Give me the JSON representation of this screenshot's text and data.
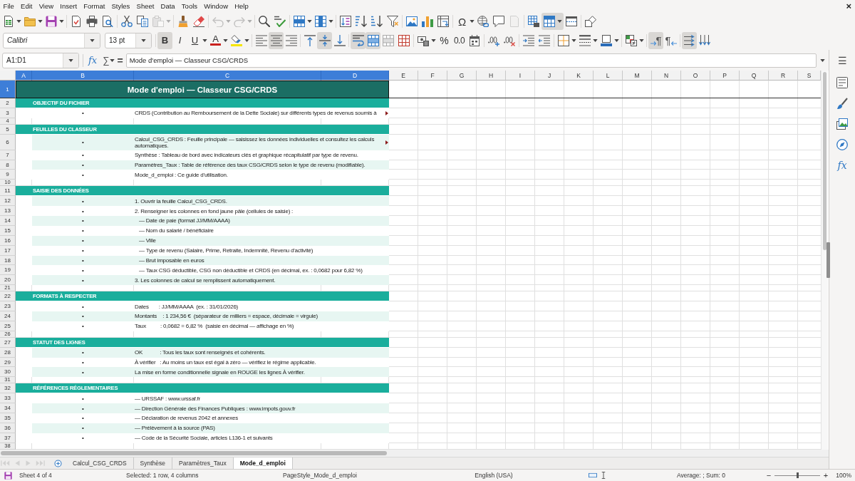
{
  "menu_bar": {
    "items": [
      "File",
      "Edit",
      "View",
      "Insert",
      "Format",
      "Styles",
      "Sheet",
      "Data",
      "Tools",
      "Window",
      "Help"
    ],
    "close_glyph": "×"
  },
  "standard_toolbar": {
    "paste_disabled": true,
    "undo_disabled": true,
    "redo_disabled": true,
    "header_footer_disabled": true,
    "special_character_glyph": "Ω",
    "freeze_active": true
  },
  "formatting_toolbar": {
    "font_name": "Calibri",
    "font_size": "13 pt",
    "bold": {
      "glyph": "B",
      "on": true
    },
    "italic": {
      "glyph": "I",
      "on": false
    },
    "underline": {
      "glyph": "U",
      "on": false
    },
    "font_color_glyph": "A",
    "horizontal_align": [
      {
        "kind": "left",
        "selected": false
      },
      {
        "kind": "center",
        "selected": true
      },
      {
        "kind": "right",
        "selected": false
      }
    ],
    "vertical_align": [
      {
        "kind": "top",
        "selected": false
      },
      {
        "kind": "middle",
        "selected": true
      },
      {
        "kind": "bottom",
        "selected": false
      }
    ],
    "wrap_text": true,
    "merge_and_center": true,
    "percent_glyph": "%",
    "standard_glyph": "0.0",
    "paragraph_direction": [
      {
        "kind": "ltr",
        "glyph": "¶",
        "selected": true
      },
      {
        "kind": "rtl",
        "glyph": "¶",
        "selected": false
      }
    ],
    "text_orientation": [
      {
        "kind": "horizontal",
        "selected": true
      },
      {
        "kind": "vertical",
        "selected": false
      }
    ]
  },
  "formula_bar": {
    "name_box": "A1:D1",
    "function_glyph": "fx",
    "sum_glyph": "∑",
    "equals_glyph": "=",
    "content": "Mode d'emploi — Classeur CSG/CRDS"
  },
  "sidebar": {
    "menu_glyph": "☰",
    "functions_glyph": "fx"
  },
  "sheet": {
    "columns": [
      {
        "label": "A",
        "selected": true
      },
      {
        "label": "B",
        "selected": true
      },
      {
        "label": "C",
        "selected": true
      },
      {
        "label": "D",
        "selected": true
      },
      {
        "label": "E",
        "selected": false
      },
      {
        "label": "F",
        "selected": false
      },
      {
        "label": "G",
        "selected": false
      },
      {
        "label": "H",
        "selected": false
      },
      {
        "label": "I",
        "selected": false
      },
      {
        "label": "J",
        "selected": false
      },
      {
        "label": "K",
        "selected": false
      },
      {
        "label": "L",
        "selected": false
      },
      {
        "label": "M",
        "selected": false
      },
      {
        "label": "N",
        "selected": false
      },
      {
        "label": "O",
        "selected": false
      },
      {
        "label": "P",
        "selected": false
      },
      {
        "label": "Q",
        "selected": false
      },
      {
        "label": "R",
        "selected": false
      },
      {
        "label": "S",
        "selected": false
      }
    ],
    "rows": [
      {
        "number": "1",
        "kind": "title",
        "selected": true,
        "text": "Mode d'emploi — Classeur CSG/CRDS"
      },
      {
        "number": "2",
        "kind": "section",
        "selected": false,
        "text": "OBJECTIF DU FICHIER"
      },
      {
        "number": "3",
        "kind": "item",
        "selected": false,
        "bullet": "•",
        "text": "CRDS (Contribution au Remboursement de la Dette Sociale) sur différents types de revenus soumis à",
        "shaded": false,
        "overflow": true
      },
      {
        "number": "4",
        "kind": "spacer",
        "selected": false
      },
      {
        "number": "5",
        "kind": "section",
        "selected": false,
        "text": "FEUILLES DU CLASSEUR"
      },
      {
        "number": "6",
        "kind": "item",
        "selected": false,
        "bullet": "•",
        "text": "Calcul_CSG_CRDS : Feuille principale — saisissez les données individuelles et consultez les calculs automatiques.",
        "shaded": true,
        "overflow": true
      },
      {
        "number": "7",
        "kind": "item",
        "selected": false,
        "bullet": "•",
        "text": "Synthèse : Tableau de bord avec indicateurs clés et graphique récapitulatif par type de revenu.",
        "shaded": false,
        "overflow": false
      },
      {
        "number": "8",
        "kind": "item",
        "selected": false,
        "bullet": "•",
        "text": "Paramètres_Taux : Table de référence des taux CSG/CRDS selon le type de revenu (modifiable).",
        "shaded": true,
        "overflow": false
      },
      {
        "number": "9",
        "kind": "item",
        "selected": false,
        "bullet": "•",
        "text": "Mode_d_emploi : Ce guide d'utilisation.",
        "shaded": false,
        "overflow": false
      },
      {
        "number": "10",
        "kind": "spacer",
        "selected": false
      },
      {
        "number": "11",
        "kind": "section",
        "selected": false,
        "text": "SAISIE DES DONNÉES"
      },
      {
        "number": "12",
        "kind": "item",
        "selected": false,
        "bullet": "•",
        "text": "1. Ouvrir la feuille Calcul_CSG_CRDS.",
        "shaded": true,
        "overflow": false
      },
      {
        "number": "13",
        "kind": "item",
        "selected": false,
        "bullet": "•",
        "text": "2. Renseigner les colonnes en fond jaune pâle (cellules de saisie) :",
        "shaded": false,
        "overflow": false
      },
      {
        "number": "14",
        "kind": "item",
        "selected": false,
        "bullet": "•",
        "text": "   — Date de paie (format JJ/MM/AAAA)",
        "shaded": true,
        "overflow": false
      },
      {
        "number": "15",
        "kind": "item",
        "selected": false,
        "bullet": "•",
        "text": "   — Nom du salarié / bénéficiaire",
        "shaded": false,
        "overflow": false
      },
      {
        "number": "16",
        "kind": "item",
        "selected": false,
        "bullet": "•",
        "text": "   — Ville",
        "shaded": true,
        "overflow": false
      },
      {
        "number": "17",
        "kind": "item",
        "selected": false,
        "bullet": "•",
        "text": "   — Type de revenu (Salaire, Prime, Retraite, Indemnité, Revenu d'activité)",
        "shaded": false,
        "overflow": false
      },
      {
        "number": "18",
        "kind": "item",
        "selected": false,
        "bullet": "•",
        "text": "   — Brut imposable en euros",
        "shaded": true,
        "overflow": false
      },
      {
        "number": "19",
        "kind": "item",
        "selected": false,
        "bullet": "•",
        "text": "   — Taux CSG déductible, CSG non déductible et CRDS (en décimal, ex. : 0,0682 pour 6,82 %)",
        "shaded": false,
        "overflow": false
      },
      {
        "number": "20",
        "kind": "item",
        "selected": false,
        "bullet": "•",
        "text": "3. Les colonnes de calcul se remplissent automatiquement.",
        "shaded": true,
        "overflow": false
      },
      {
        "number": "21",
        "kind": "spacer",
        "selected": false
      },
      {
        "number": "22",
        "kind": "section",
        "selected": false,
        "text": "FORMATS À RESPECTER"
      },
      {
        "number": "23",
        "kind": "item",
        "selected": false,
        "bullet": "•",
        "text": "Dates       : JJ/MM/AAAA  (ex. : 31/01/2026)",
        "shaded": false,
        "overflow": false
      },
      {
        "number": "24",
        "kind": "item",
        "selected": false,
        "bullet": "•",
        "text": "Montants    : 1 234,56 €  (séparateur de milliers = espace, décimale = virgule)",
        "shaded": true,
        "overflow": false
      },
      {
        "number": "25",
        "kind": "item",
        "selected": false,
        "bullet": "•",
        "text": "Taux          : 0,0682 = 6,82 %  (saisie en décimal — affichage en %)",
        "shaded": false,
        "overflow": false
      },
      {
        "number": "26",
        "kind": "spacer",
        "selected": false
      },
      {
        "number": "27",
        "kind": "section",
        "selected": false,
        "text": "STATUT DES LIGNES"
      },
      {
        "number": "28",
        "kind": "item",
        "selected": false,
        "bullet": "•",
        "text": "OK            : Tous les taux sont renseignés et cohérents.",
        "shaded": true,
        "overflow": false
      },
      {
        "number": "29",
        "kind": "item",
        "selected": false,
        "bullet": "•",
        "text": "À vérifier   : Au moins un taux est égal à zéro — vérifiez le régime applicable.",
        "shaded": false,
        "overflow": false
      },
      {
        "number": "30",
        "kind": "item",
        "selected": false,
        "bullet": "•",
        "text": "La mise en forme conditionnelle signale en ROUGE les lignes À vérifier.",
        "shaded": true,
        "overflow": false
      },
      {
        "number": "31",
        "kind": "spacer",
        "selected": false
      },
      {
        "number": "32",
        "kind": "section",
        "selected": false,
        "text": "RÉFÉRENCES RÉGLEMENTAIRES"
      },
      {
        "number": "33",
        "kind": "item",
        "selected": false,
        "bullet": "•",
        "text": "— URSSAF : www.urssaf.fr",
        "shaded": false,
        "overflow": false
      },
      {
        "number": "34",
        "kind": "item",
        "selected": false,
        "bullet": "•",
        "text": "— Direction Générale des Finances Publiques : www.impots.gouv.fr",
        "shaded": true,
        "overflow": false
      },
      {
        "number": "35",
        "kind": "item",
        "selected": false,
        "bullet": "•",
        "text": "— Déclaration de revenus 2042 et annexes",
        "shaded": false,
        "overflow": false
      },
      {
        "number": "36",
        "kind": "item",
        "selected": false,
        "bullet": "•",
        "text": "— Prélèvement à la source (PAS)",
        "shaded": true,
        "overflow": false
      },
      {
        "number": "37",
        "kind": "item",
        "selected": false,
        "bullet": "•",
        "text": "— Code de la Sécurité Sociale, articles L136-1 et suivants",
        "shaded": false,
        "overflow": false
      },
      {
        "number": "38",
        "kind": "spacer",
        "selected": false
      }
    ]
  },
  "sheet_tab_bar": {
    "navigation_disabled": true,
    "tabs": [
      {
        "label": "Calcul_CSG_CRDS",
        "selected": false
      },
      {
        "label": "Synthèse",
        "selected": false
      },
      {
        "label": "Paramètres_Taux",
        "selected": false
      },
      {
        "label": "Mode_d_emploi",
        "selected": true
      }
    ]
  },
  "status_bar": {
    "sheet": "Sheet 4 of 4",
    "selection": "Selected: 1 row, 4 columns",
    "page_style": "PageStyle_Mode_d_emploi",
    "language": "English (USA)",
    "summary": "Average: ; Sum: 0",
    "zoom": {
      "out_glyph": "−",
      "level": 0.5,
      "in_glyph": "+",
      "percent": "100%"
    }
  }
}
